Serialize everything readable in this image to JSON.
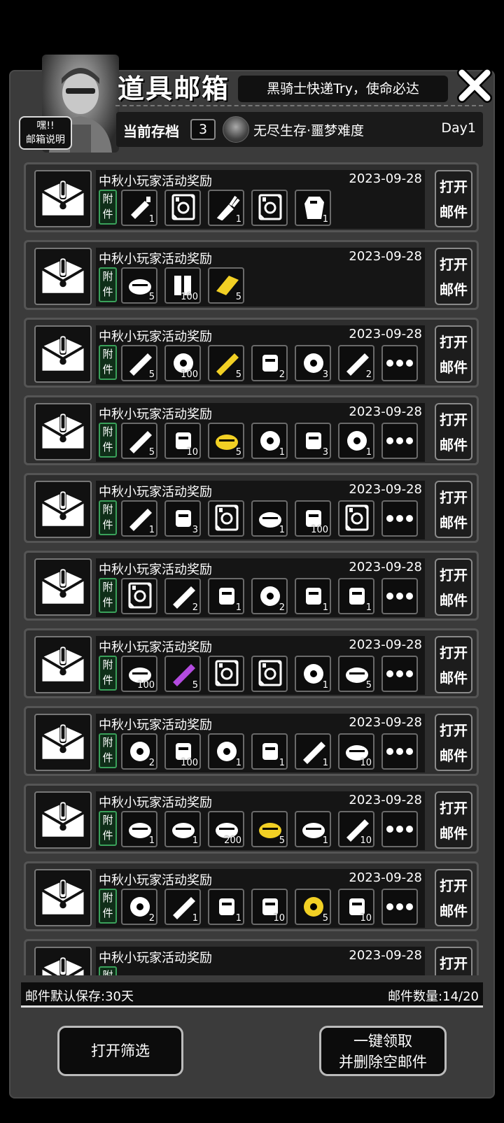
{
  "header": {
    "title": "道具邮箱",
    "slogan": "黑骑士快递Try，使命必达",
    "help_line1": "嘿!!",
    "help_line2": "邮箱说明"
  },
  "save": {
    "label": "当前存档",
    "slot": "3",
    "mode": "无尽生存·噩梦难度",
    "day": "Day1"
  },
  "mail_common": {
    "title": "中秋小玩家活动奖励",
    "date": "2023-09-28",
    "attach_line1": "附",
    "attach_line2": "件",
    "open_line1": "打开",
    "open_line2": "邮件"
  },
  "mails": [
    {
      "items": [
        {
          "icon": "glue-tube-icon",
          "qty": "1",
          "color": "#ffffff"
        },
        {
          "icon": "blueprint-safe-icon",
          "qty": "",
          "color": "#ffffff"
        },
        {
          "icon": "pliers-icon",
          "qty": "1",
          "color": "#ffffff"
        },
        {
          "icon": "blueprint-turret-icon",
          "qty": "",
          "color": "#ffffff"
        },
        {
          "icon": "riot-shield-icon",
          "qty": "1",
          "color": "#ffffff"
        }
      ],
      "more": false
    },
    {
      "items": [
        {
          "icon": "food-box-icon",
          "qty": "5",
          "color": "#ffffff"
        },
        {
          "icon": "bandage-roll-icon",
          "qty": "100",
          "color": "#ffffff"
        },
        {
          "icon": "gold-bar-icon",
          "qty": "5",
          "color": "#f2d024"
        }
      ],
      "more": false
    },
    {
      "items": [
        {
          "icon": "coffee-cup-icon",
          "qty": "5",
          "color": "#ffffff"
        },
        {
          "icon": "glue-pile-icon",
          "qty": "100",
          "color": "#ffffff"
        },
        {
          "icon": "bamboo-sticks-icon",
          "qty": "5",
          "color": "#f2d024"
        },
        {
          "icon": "metal-rods-icon",
          "qty": "2",
          "color": "#ffffff"
        },
        {
          "icon": "scrap-box-icon",
          "qty": "3",
          "color": "#ffffff"
        },
        {
          "icon": "syringe-icon",
          "qty": "2",
          "color": "#ffffff"
        }
      ],
      "more": true
    },
    {
      "items": [
        {
          "icon": "cloth-icon",
          "qty": "5",
          "color": "#ffffff"
        },
        {
          "icon": "spray-can-icon",
          "qty": "10",
          "color": "#ffffff"
        },
        {
          "icon": "gold-nuggets-icon",
          "qty": "5",
          "color": "#f2d024"
        },
        {
          "icon": "ampoules-icon",
          "qty": "1",
          "color": "#ffffff"
        },
        {
          "icon": "gift-crate-icon",
          "qty": "3",
          "color": "#ffffff"
        },
        {
          "icon": "crowbar-icon",
          "qty": "1",
          "color": "#ffffff"
        }
      ],
      "more": true
    },
    {
      "items": [
        {
          "icon": "helmet-icon",
          "qty": "1",
          "color": "#ffffff"
        },
        {
          "icon": "food-crate-icon",
          "qty": "3",
          "color": "#ffffff"
        },
        {
          "icon": "blueprint-shield-icon",
          "qty": "",
          "color": "#ffffff"
        },
        {
          "icon": "engine-part-icon",
          "qty": "1",
          "color": "#ffffff"
        },
        {
          "icon": "bullets-icon",
          "qty": "100",
          "color": "#ffffff"
        },
        {
          "icon": "blueprint-bow-icon",
          "qty": "",
          "color": "#ffffff"
        }
      ],
      "more": true
    },
    {
      "items": [
        {
          "icon": "blueprint-bow-icon",
          "qty": "",
          "color": "#ffffff"
        },
        {
          "icon": "syringe-icon",
          "qty": "2",
          "color": "#ffffff"
        },
        {
          "icon": "tire-icon",
          "qty": "1",
          "color": "#ffffff"
        },
        {
          "icon": "burger-icon",
          "qty": "2",
          "color": "#ffffff"
        },
        {
          "icon": "shotgun-icon",
          "qty": "1",
          "color": "#ffffff"
        },
        {
          "icon": "plank-icon",
          "qty": "1",
          "color": "#ffffff"
        }
      ],
      "more": true
    },
    {
      "items": [
        {
          "icon": "oil-barrel-icon",
          "qty": "100",
          "color": "#ffffff"
        },
        {
          "icon": "energy-cell-icon",
          "qty": "5",
          "color": "#b44be0"
        },
        {
          "icon": "blueprint-turret-icon",
          "qty": "",
          "color": "#ffffff"
        },
        {
          "icon": "blueprint-knife-icon",
          "qty": "",
          "color": "#ffffff"
        },
        {
          "icon": "armor-vest-icon",
          "qty": "1",
          "color": "#ffffff"
        },
        {
          "icon": "cloth-sheet-icon",
          "qty": "5",
          "color": "#ffffff"
        }
      ],
      "more": true
    },
    {
      "items": [
        {
          "icon": "pipe-icon",
          "qty": "2",
          "color": "#ffffff"
        },
        {
          "icon": "bullets-icon",
          "qty": "100",
          "color": "#ffffff"
        },
        {
          "icon": "engine-icon",
          "qty": "1",
          "color": "#ffffff"
        },
        {
          "icon": "motor-block-icon",
          "qty": "1",
          "color": "#ffffff"
        },
        {
          "icon": "lamp-icon",
          "qty": "1",
          "color": "#ffffff"
        },
        {
          "icon": "grenade-icon",
          "qty": "10",
          "color": "#ffffff"
        }
      ],
      "more": true
    },
    {
      "items": [
        {
          "icon": "rifle-icon",
          "qty": "1",
          "color": "#ffffff"
        },
        {
          "icon": "engine-part-icon",
          "qty": "1",
          "color": "#ffffff"
        },
        {
          "icon": "bricks-icon",
          "qty": "200",
          "color": "#ffffff"
        },
        {
          "icon": "gold-parts-icon",
          "qty": "5",
          "color": "#f2d024"
        },
        {
          "icon": "gear-parts-icon",
          "qty": "1",
          "color": "#ffffff"
        },
        {
          "icon": "food-bowl-icon",
          "qty": "10",
          "color": "#ffffff"
        }
      ],
      "more": true
    },
    {
      "items": [
        {
          "icon": "toolbox-icon",
          "qty": "2",
          "color": "#ffffff"
        },
        {
          "icon": "car-seat-icon",
          "qty": "1",
          "color": "#ffffff"
        },
        {
          "icon": "pistol-icon",
          "qty": "1",
          "color": "#ffffff"
        },
        {
          "icon": "spear-icon",
          "qty": "10",
          "color": "#ffffff"
        },
        {
          "icon": "gold-planks-icon",
          "qty": "5",
          "color": "#f2d024"
        },
        {
          "icon": "vase-icon",
          "qty": "10",
          "color": "#ffffff"
        }
      ],
      "more": true
    },
    {
      "items": [],
      "more": false
    }
  ],
  "footer": {
    "retention": "邮件默认保存:30天",
    "count": "邮件数量:14/20"
  },
  "buttons": {
    "filter": "打开筛选",
    "claim_line1": "一键领取",
    "claim_line2": "并删除空邮件"
  }
}
